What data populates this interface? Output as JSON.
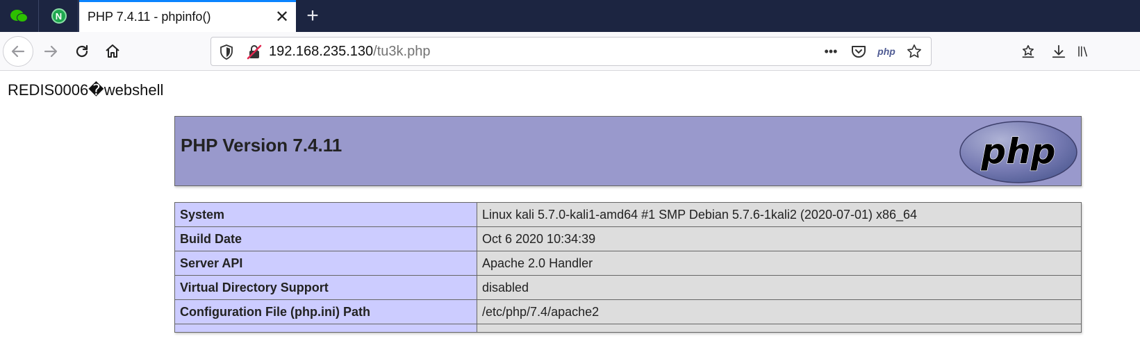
{
  "browser": {
    "pinned_tabs": [
      {
        "icon": "wechat-icon"
      },
      {
        "icon": "nginx-icon",
        "letter": "N"
      }
    ],
    "active_tab": {
      "title": "PHP 7.4.11 - phpinfo()",
      "close": "✕"
    },
    "new_tab": "+",
    "url": {
      "host": "192.168.235.130",
      "path": "/tu3k.php"
    },
    "url_actions": {
      "more": "•••",
      "php_label": "php"
    }
  },
  "page": {
    "echo_text": "REDIS0006�webshell",
    "header": {
      "version_title": "PHP Version 7.4.11",
      "logo_text": "php"
    },
    "info_rows": [
      {
        "key": "System",
        "value": "Linux kali 5.7.0-kali1-amd64 #1 SMP Debian 5.7.6-1kali2 (2020-07-01) x86_64"
      },
      {
        "key": "Build Date",
        "value": "Oct 6 2020 10:34:39"
      },
      {
        "key": "Server API",
        "value": "Apache 2.0 Handler"
      },
      {
        "key": "Virtual Directory Support",
        "value": "disabled"
      },
      {
        "key": "Configuration File (php.ini) Path",
        "value": "/etc/php/7.4/apache2"
      }
    ]
  },
  "colors": {
    "tab_strip": "#1c2541",
    "accent": "#0a84ff",
    "php_header": "#9999cc",
    "key_cell": "#ccccff",
    "value_cell": "#dddddd"
  }
}
